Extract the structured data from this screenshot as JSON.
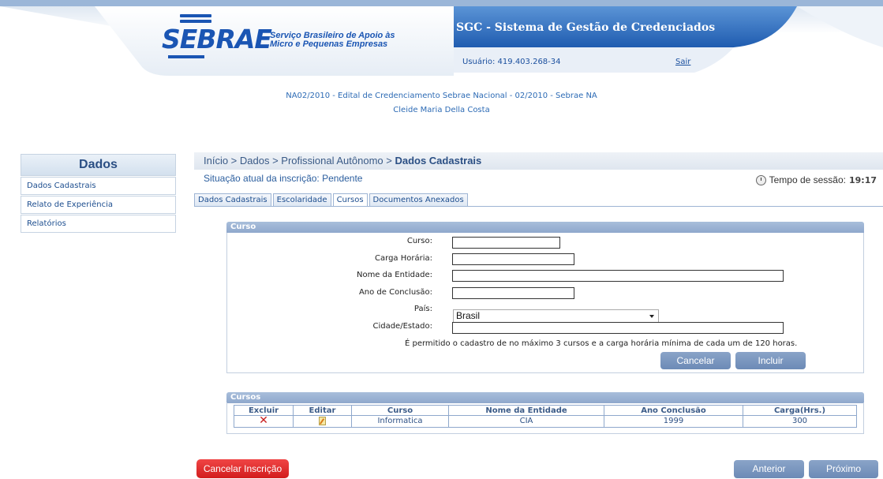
{
  "header": {
    "logo_text": "SEBRAE",
    "logo_tagline_line1": "Serviço Brasileiro de Apoio às",
    "logo_tagline_line2": "Micro e Pequenas Empresas",
    "system_title": "SGC - Sistema de Gestão de Credenciados",
    "user_label": "Usuário: 419.403.268-34",
    "logout_label": "Sair",
    "brand_blue": "#1a55b3",
    "banner_blue": "#2f6ec2"
  },
  "edital": {
    "line1": "NA02/2010 - Edital de Credenciamento Sebrae Nacional - 02/2010 - Sebrae NA",
    "line2": "Cleide Maria Della Costa"
  },
  "sidebar": {
    "title": "Dados",
    "items": [
      {
        "label": "Dados Cadastrais"
      },
      {
        "label": "Relato de Experiência"
      },
      {
        "label": "Relatórios"
      }
    ]
  },
  "breadcrumb": {
    "prefix": "Início > Dados > Profissional Autônomo > ",
    "current": "Dados Cadastrais"
  },
  "status": {
    "label": "Situação atual da inscrição: Pendente",
    "session_label": "Tempo de sessão:",
    "session_time": "19:17"
  },
  "tabs": [
    {
      "label": "Dados Cadastrais",
      "active": false
    },
    {
      "label": "Escolaridade",
      "active": false
    },
    {
      "label": "Cursos",
      "active": true
    },
    {
      "label": "Documentos Anexados",
      "active": false
    }
  ],
  "form": {
    "title": "Curso",
    "fields": {
      "curso": {
        "label": "Curso:",
        "value": ""
      },
      "carga": {
        "label": "Carga Horária:",
        "value": ""
      },
      "entidade": {
        "label": "Nome da Entidade:",
        "value": ""
      },
      "ano": {
        "label": "Ano de Conclusão:",
        "value": ""
      },
      "pais": {
        "label": "País:",
        "value": "Brasil"
      },
      "cidade": {
        "label": "Cidade/Estado:",
        "value": ""
      }
    },
    "note": "É permitido o cadastro de no máximo 3 cursos e a carga horária mínima de cada um de 120 horas.",
    "cancel_label": "Cancelar",
    "add_label": "Incluir"
  },
  "courses": {
    "title": "Cursos",
    "headers": [
      "Excluir",
      "Editar",
      "Curso",
      "Nome da Entidade",
      "Ano Conclusão",
      "Carga(Hrs.)"
    ],
    "rows": [
      {
        "curso": "Informatica",
        "entidade": "CIA",
        "ano": "1999",
        "carga": "300"
      }
    ]
  },
  "footer": {
    "cancel_registration_label": "Cancelar Inscrição",
    "previous_label": "Anterior",
    "next_label": "Próximo"
  }
}
